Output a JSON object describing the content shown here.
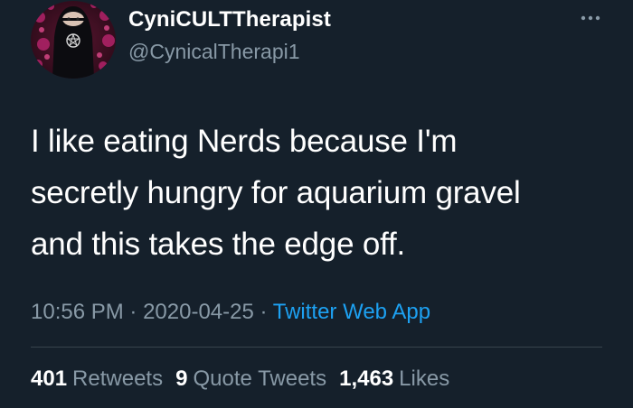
{
  "user": {
    "display_name": "CyniCULTTherapist",
    "handle": "@CynicalTherapi1"
  },
  "tweet": {
    "lines": [
      "I like eating Nerds because I'm",
      "secretly hungry for aquarium gravel",
      "and this takes the edge off."
    ],
    "time": "10:56 PM",
    "separator": "·",
    "date": "2020-04-25",
    "source": "Twitter Web App"
  },
  "stats": {
    "retweets_count": "401",
    "retweets_label": "Retweets",
    "quotes_count": "9",
    "quotes_label": "Quote Tweets",
    "likes_count": "1,463",
    "likes_label": "Likes"
  },
  "icons": {
    "more": "more-horizontal-icon",
    "avatar": "avatar-image"
  },
  "colors": {
    "background": "#15202b",
    "text_primary": "#ffffff",
    "text_secondary": "#8899a6",
    "link": "#1da1f2",
    "divider": "#38444d"
  }
}
